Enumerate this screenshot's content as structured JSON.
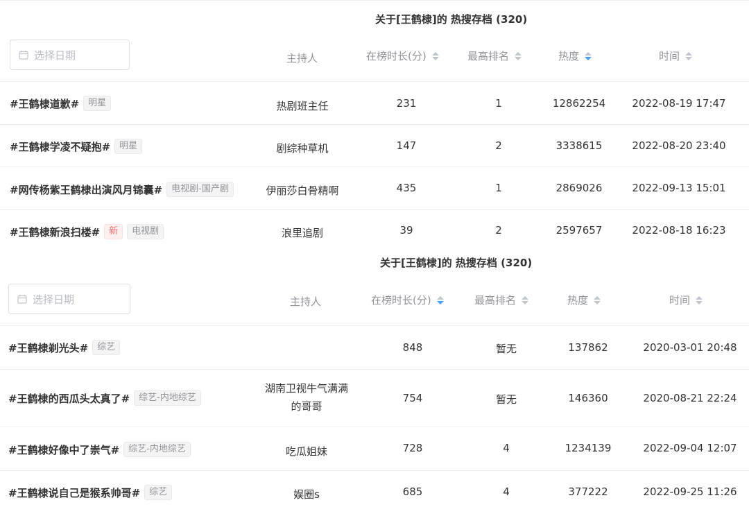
{
  "panels": [
    {
      "title": "关于[王鹤棣]的 热搜存档 (320)",
      "date_placeholder": "选择日期",
      "columns": {
        "host": "主持人",
        "duration": "在榜时长(分)",
        "rank": "最高排名",
        "heat": "热度",
        "time": "时间"
      },
      "active_sort": "heat",
      "rows": [
        {
          "topic": "#王鹤棣道歉#",
          "tags": [
            "明星"
          ],
          "host": "热剧班主任",
          "duration": "231",
          "rank": "1",
          "heat": "12862254",
          "time": "2022-08-19 17:47"
        },
        {
          "topic": "#王鹤棣学凌不疑抱#",
          "tags": [
            "明星"
          ],
          "host": "剧综种草机",
          "duration": "147",
          "rank": "2",
          "heat": "3338615",
          "time": "2022-08-20 23:40"
        },
        {
          "topic": "#网传杨紫王鹤棣出演风月锦囊#",
          "tags": [
            "电视剧-国产剧"
          ],
          "host": "伊丽莎白骨精啊",
          "duration": "435",
          "rank": "1",
          "heat": "2869026",
          "time": "2022-09-13 15:01"
        },
        {
          "topic": "#王鹤棣新浪扫楼#",
          "tags": [
            "新",
            "电视剧"
          ],
          "host": "浪里追剧",
          "duration": "39",
          "rank": "2",
          "heat": "2597657",
          "time": "2022-08-18 16:23"
        }
      ]
    },
    {
      "title": "关于[王鹤棣]的 热搜存档 (320)",
      "date_placeholder": "选择日期",
      "columns": {
        "host": "主持人",
        "duration": "在榜时长(分)",
        "rank": "最高排名",
        "heat": "热度",
        "time": "时间"
      },
      "active_sort": "duration",
      "rows": [
        {
          "topic": "#王鹤棣剃光头#",
          "tags": [
            "综艺"
          ],
          "host": "",
          "duration": "848",
          "rank": "暂无",
          "heat": "137862",
          "time": "2020-03-01 20:48"
        },
        {
          "topic": "#王鹤棣的西瓜头太真了#",
          "tags": [
            "综艺-内地综艺"
          ],
          "host": "湖南卫视牛气满满的哥哥",
          "duration": "754",
          "rank": "暂无",
          "heat": "146360",
          "time": "2020-08-21 22:24"
        },
        {
          "topic": "#王鹤棣好像中了崇气#",
          "tags": [
            "综艺-内地综艺"
          ],
          "host": "吃瓜姐妹",
          "duration": "728",
          "rank": "4",
          "heat": "1234139",
          "time": "2022-09-04 12:07"
        },
        {
          "topic": "#王鹤棣说自己是猴系帅哥#",
          "tags": [
            "综艺"
          ],
          "host": "娱圈s",
          "duration": "685",
          "rank": "4",
          "heat": "377222",
          "time": "2022-09-25 11:26"
        }
      ]
    }
  ]
}
